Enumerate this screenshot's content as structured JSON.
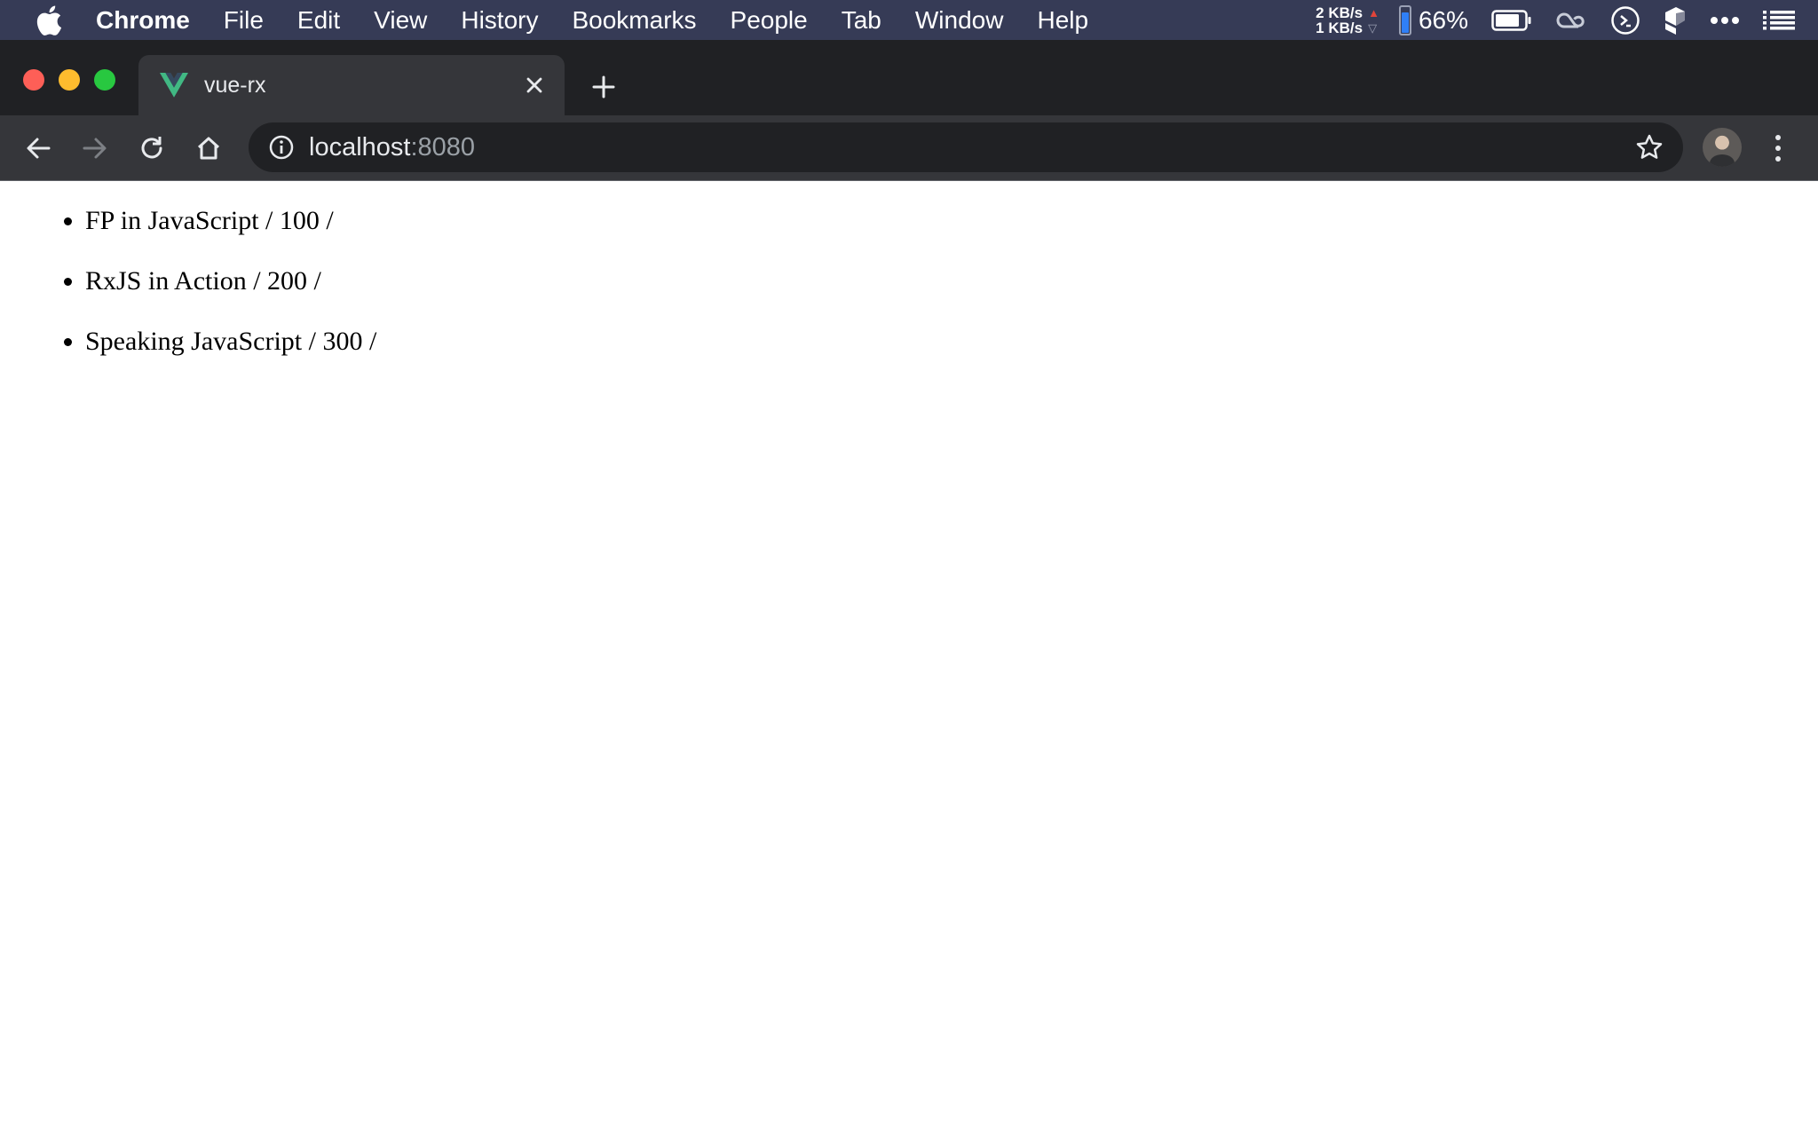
{
  "menubar": {
    "app_name": "Chrome",
    "items": [
      "File",
      "Edit",
      "View",
      "History",
      "Bookmarks",
      "People",
      "Tab",
      "Window",
      "Help"
    ],
    "net_up": "2 KB/s",
    "net_down": "1 KB/s",
    "cpu_level": 0.75,
    "battery_percent": "66%",
    "icons": [
      "apple-icon",
      "battery-icon",
      "creative-cloud-icon",
      "script-icon",
      "dropbox-icon",
      "more-dots-icon",
      "list-icon"
    ]
  },
  "tabs": [
    {
      "title": "vue-rx",
      "favicon": "vue-logo-icon",
      "active": true
    }
  ],
  "toolbar": {
    "url_host": "localhost",
    "url_port": ":8080",
    "icons": [
      "back-icon",
      "forward-icon",
      "reload-icon",
      "home-icon",
      "info-icon",
      "star-icon",
      "profile-avatar",
      "menu-dots-icon"
    ]
  },
  "page": {
    "books": [
      "FP in JavaScript / 100 /",
      "RxJS in Action / 200 /",
      "Speaking JavaScript / 300 /"
    ]
  },
  "colors": {
    "menubar_bg": "#363b56",
    "tabstrip_bg": "#202124",
    "toolbar_bg": "#35363a",
    "vue_green": "#41b883",
    "vue_dark": "#35495e"
  }
}
